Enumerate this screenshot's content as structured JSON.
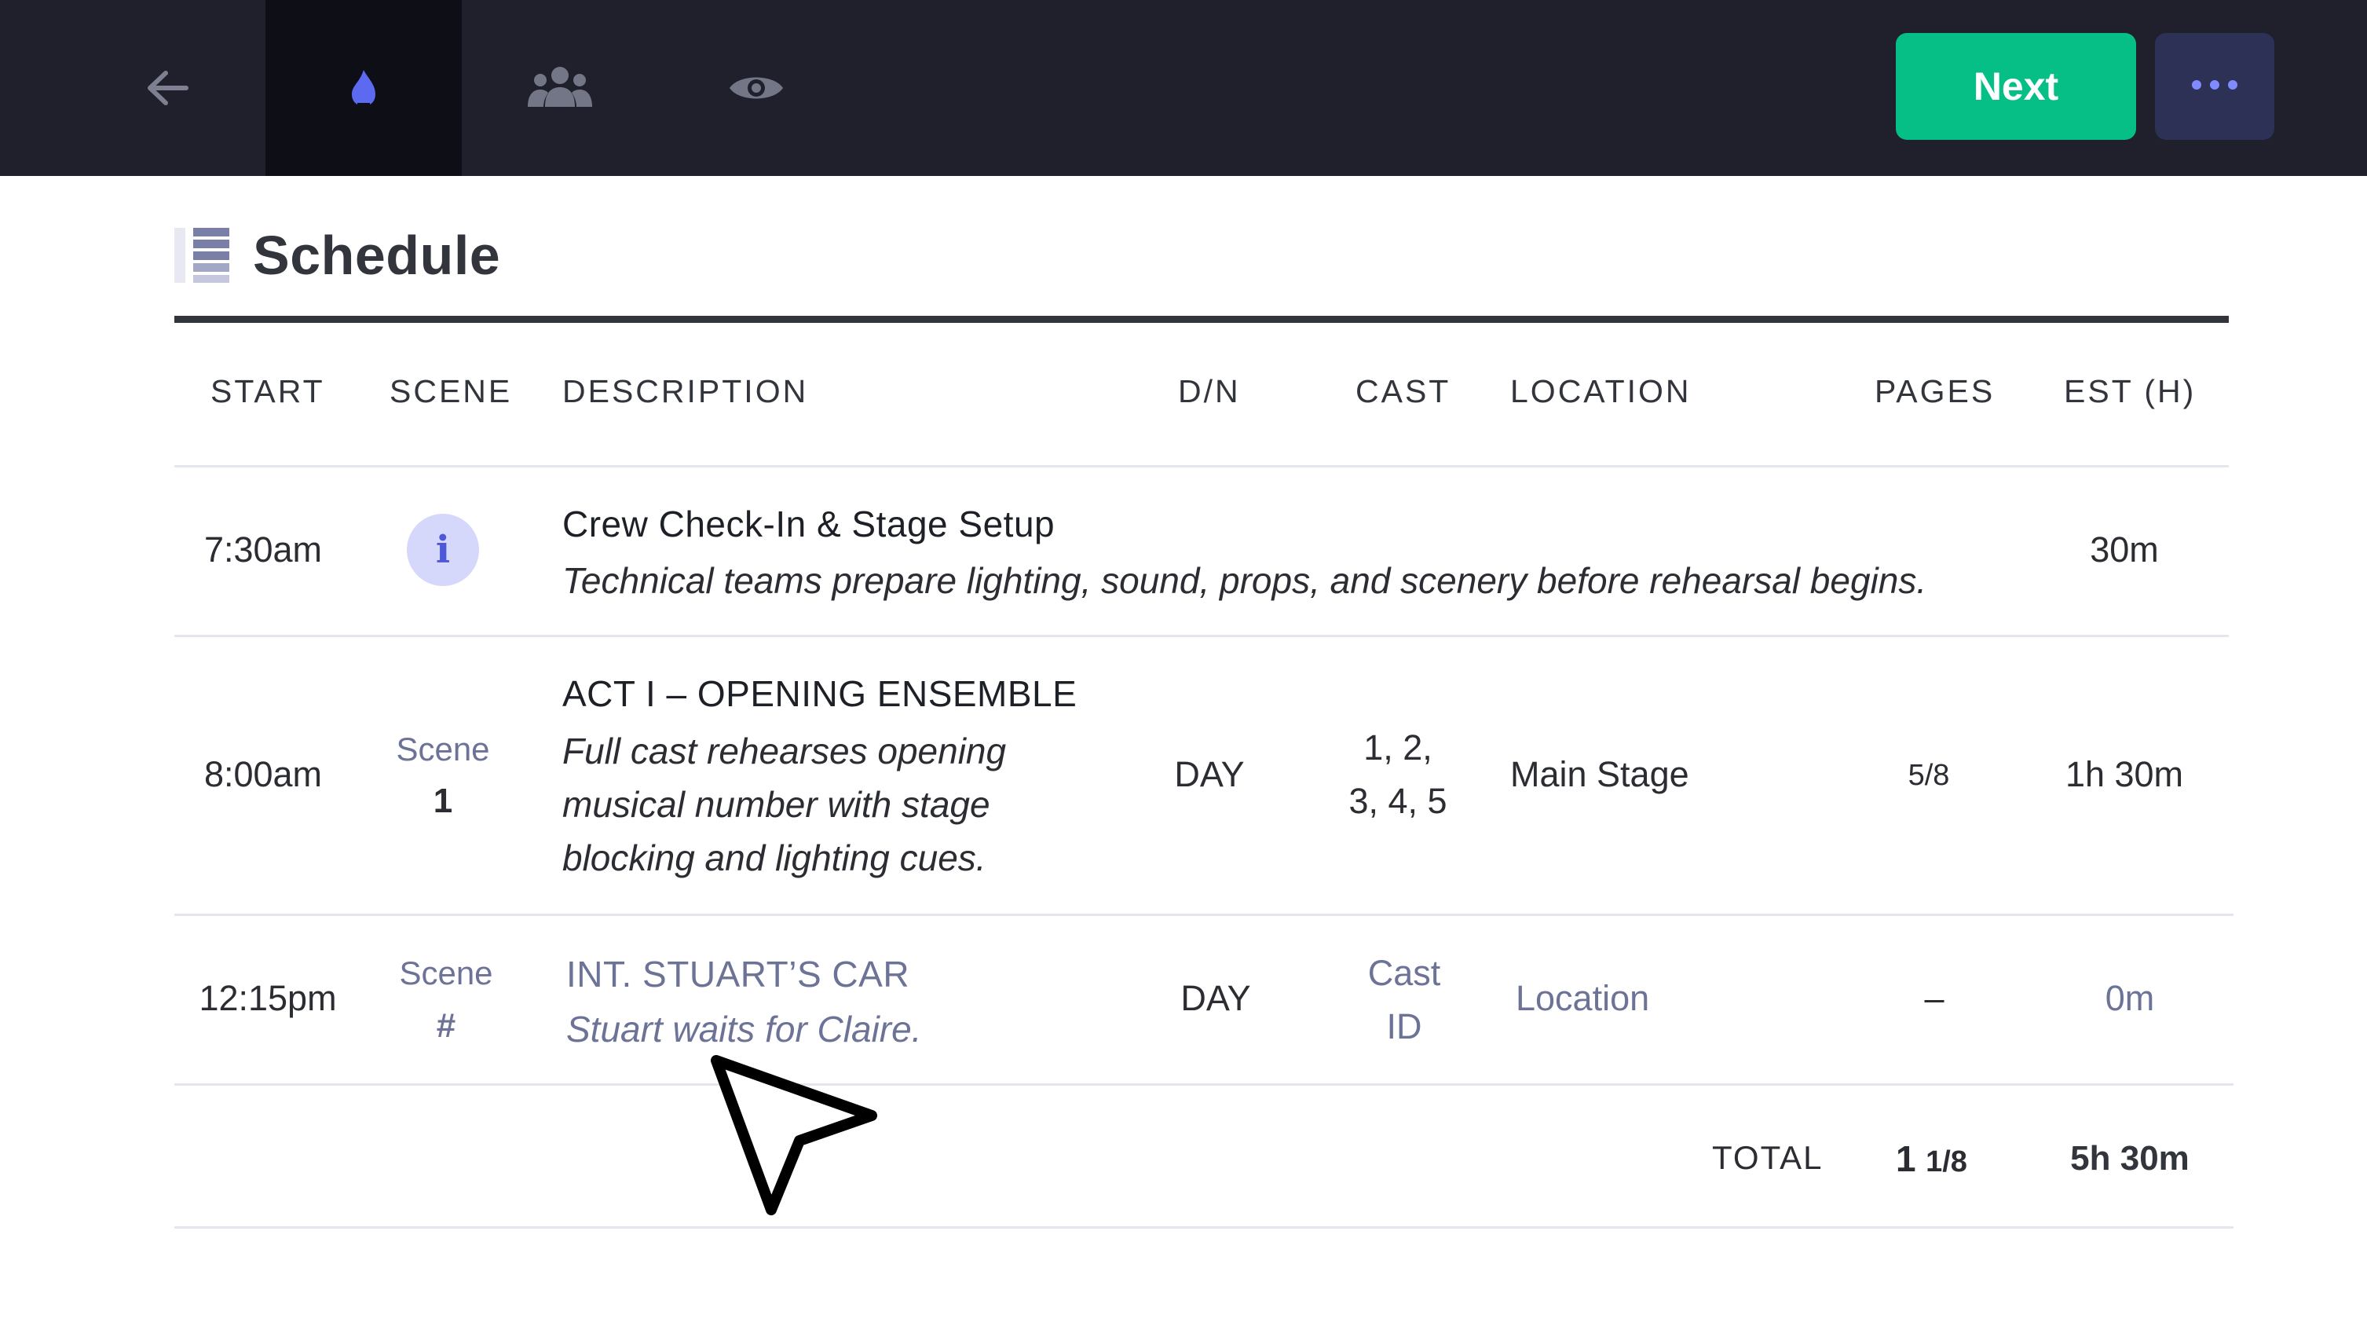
{
  "toolbar": {
    "nav_icons": [
      "back-arrow-icon",
      "flame-icon",
      "people-icon",
      "eye-icon"
    ],
    "next_label": "Next",
    "more_icon": "ellipsis-icon",
    "colors": {
      "bar": "#1f202c",
      "active_tab": "#0d0e16",
      "next": "#06bf86",
      "more": "#2c3155",
      "accent": "#5b6af0"
    }
  },
  "page": {
    "title": "Schedule",
    "title_icon": "list-icon"
  },
  "table": {
    "columns": [
      "START",
      "SCENE",
      "DESCRIPTION",
      "D/N",
      "CAST",
      "LOCATION",
      "PAGES",
      "EST (H)"
    ],
    "rows": [
      {
        "start": "7:30am",
        "scene_icon": "info-icon",
        "scene_badge": "i",
        "title": "Crew Check-In & Stage Setup",
        "description": "Technical teams prepare lighting, sound, props, and scenery before rehearsal begins.",
        "est": "30m"
      },
      {
        "start": "8:00am",
        "scene_label": "Scene",
        "scene_number": "1",
        "title": "ACT I – OPENING ENSEMBLE",
        "description_lines": [
          "Full cast rehearses opening",
          "musical number with stage",
          "blocking and lighting cues."
        ],
        "dn": "DAY",
        "cast_lines": [
          "1, 2,",
          "3, 4, 5"
        ],
        "location": "Main Stage",
        "pages": "5/8",
        "est": "1h 30m"
      },
      {
        "start": "12:15pm",
        "scene_label": "Scene",
        "scene_number": "#",
        "title": "INT. STUART’S CAR",
        "description": "Stuart waits for Claire.",
        "dn": "DAY",
        "cast_lines": [
          "Cast",
          "ID"
        ],
        "location": "Location",
        "pages": "–",
        "est": "0m"
      }
    ],
    "total": {
      "label": "TOTAL",
      "pages_whole": "1",
      "pages_fraction": "1/8",
      "est": "5h 30m"
    }
  }
}
